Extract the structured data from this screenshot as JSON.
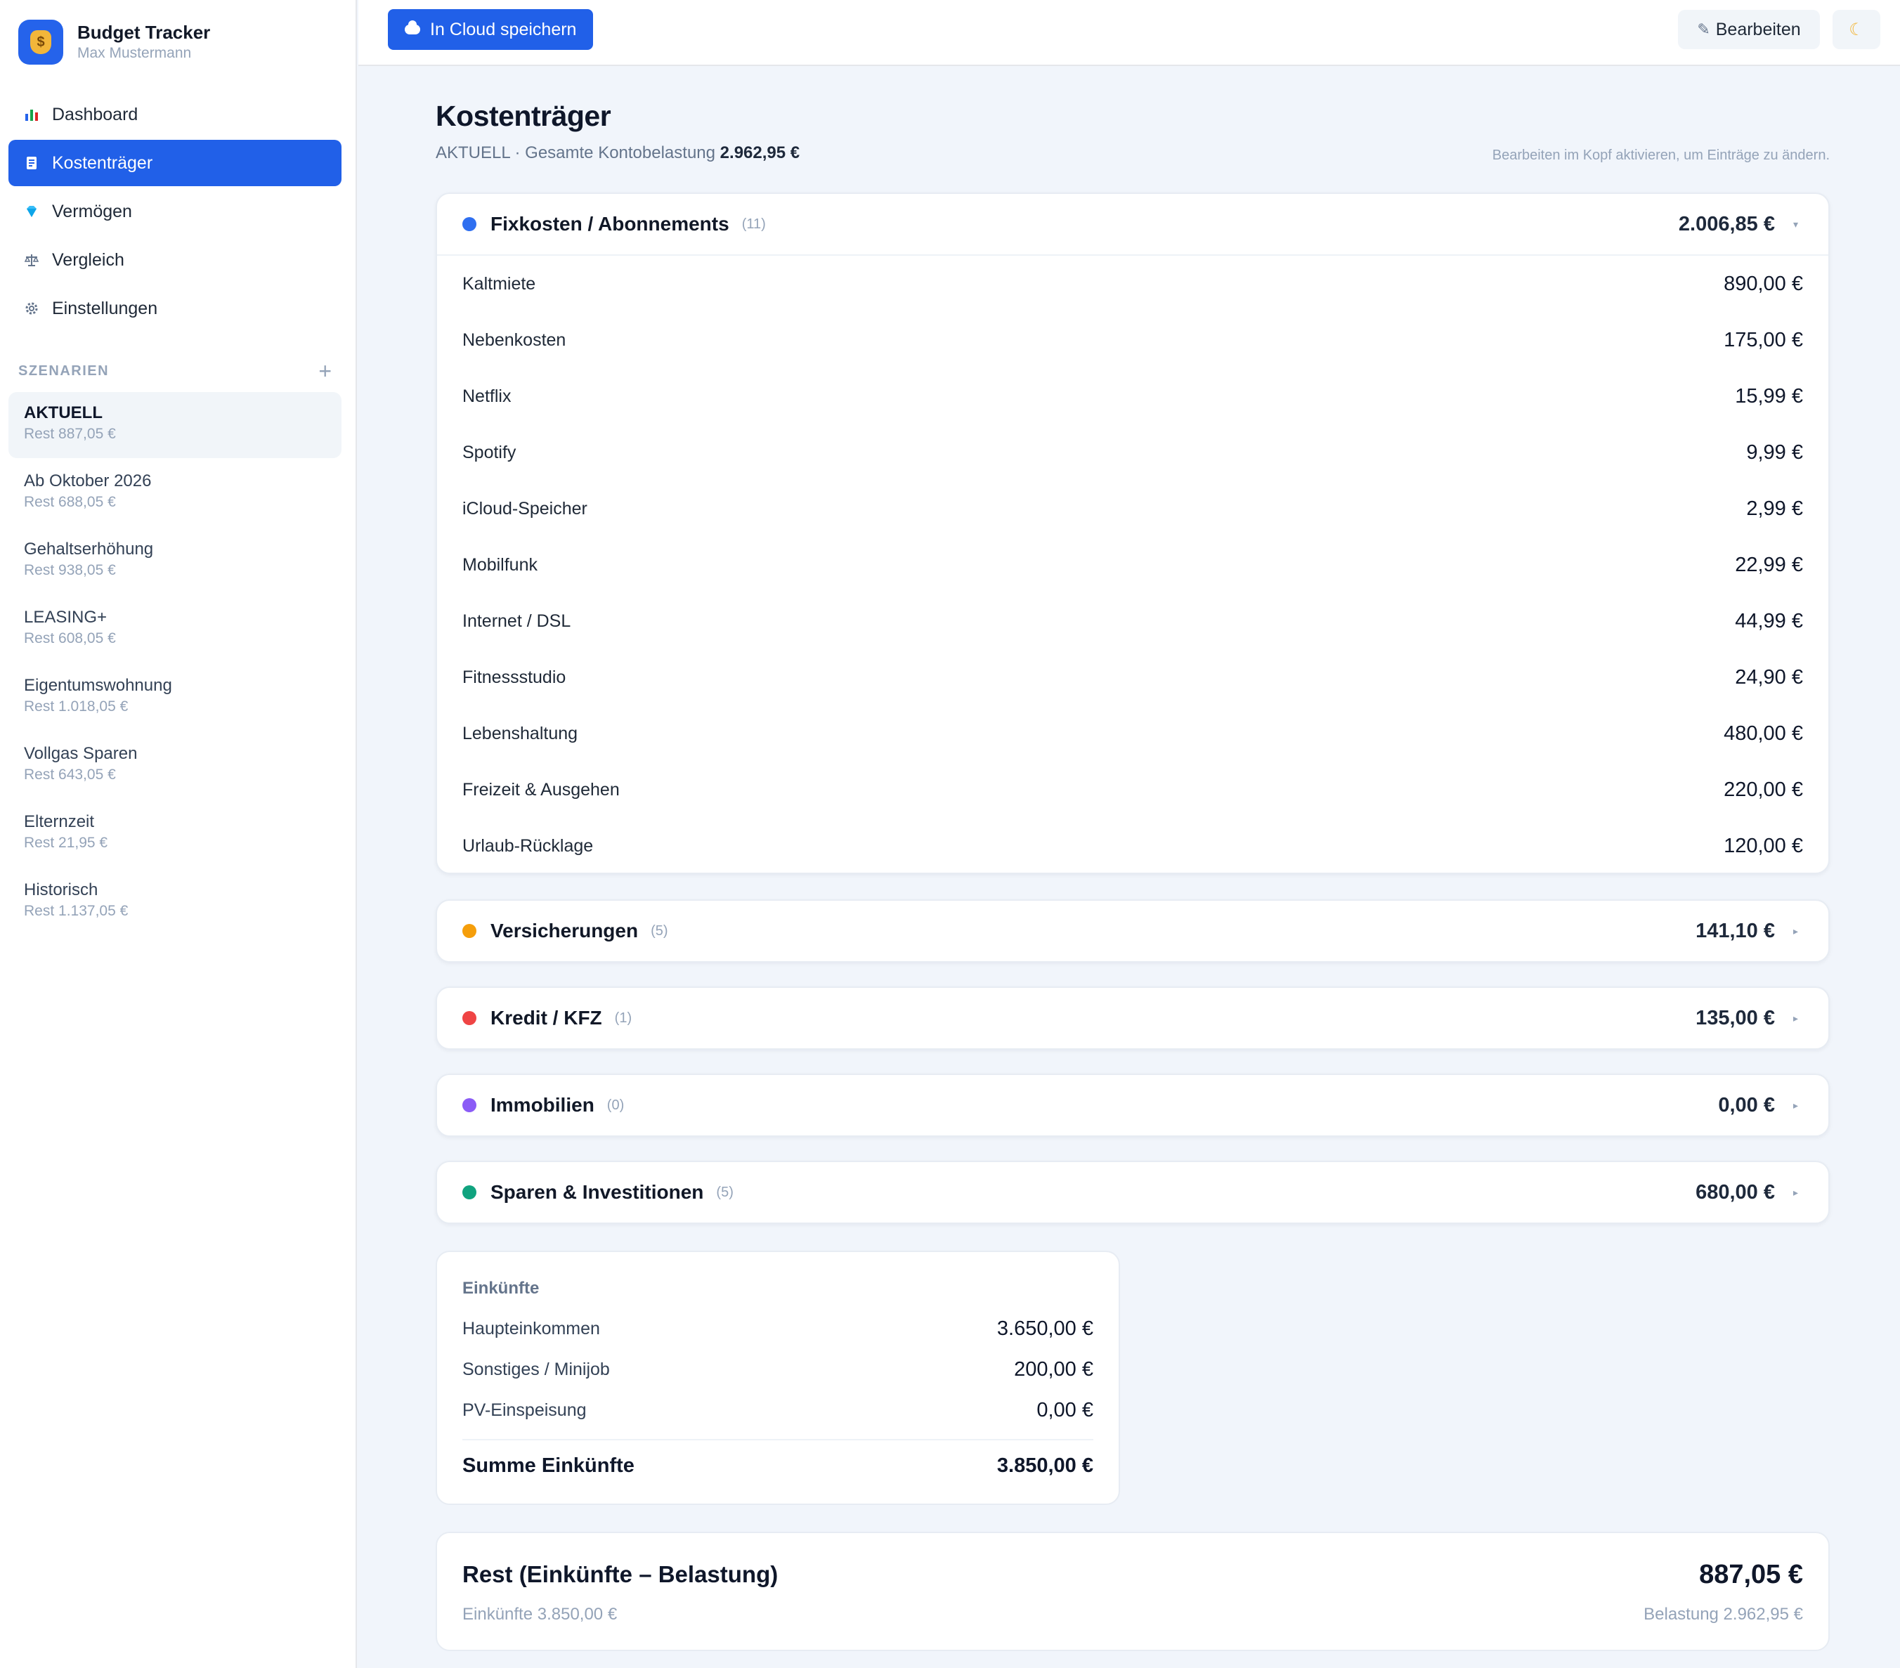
{
  "app": {
    "title": "Budget Tracker",
    "user": "Max Mustermann",
    "logo_icon": "money-bag-icon"
  },
  "nav": {
    "items": [
      {
        "label": "Dashboard",
        "icon": "bar-chart-icon",
        "active": false
      },
      {
        "label": "Kostenträger",
        "icon": "receipt-icon",
        "active": true
      },
      {
        "label": "Vermögen",
        "icon": "gem-icon",
        "active": false
      },
      {
        "label": "Vergleich",
        "icon": "scales-icon",
        "active": false
      },
      {
        "label": "Einstellungen",
        "icon": "gear-icon",
        "active": false
      }
    ]
  },
  "scenarios": {
    "title": "SZENARIEN",
    "add": "+",
    "items": [
      {
        "name": "AKTUELL",
        "rest": "Rest 887,05 €",
        "active": true
      },
      {
        "name": "Ab Oktober 2026",
        "rest": "Rest 688,05 €"
      },
      {
        "name": "Gehaltserhöhung",
        "rest": "Rest 938,05 €"
      },
      {
        "name": "LEASING+",
        "rest": "Rest 608,05 €"
      },
      {
        "name": "Eigentumswohnung",
        "rest": "Rest 1.018,05 €"
      },
      {
        "name": "Vollgas Sparen",
        "rest": "Rest 643,05 €"
      },
      {
        "name": "Elternzeit",
        "rest": "Rest 21,95 €"
      },
      {
        "name": "Historisch",
        "rest": "Rest 1.137,05 €"
      }
    ]
  },
  "topbar": {
    "cloud_label": "In Cloud speichern",
    "edit_label": "Bearbeiten",
    "theme_icon": "moon-icon"
  },
  "page": {
    "title": "Kostenträger",
    "subtitle_prefix": "AKTUELL · Gesamte Kontobelastung",
    "subtitle_value": "2.962,95 €",
    "hint": "Bearbeiten im Kopf aktivieren, um Einträge zu ändern."
  },
  "categories": [
    {
      "name": "Fixkosten / Abonnements",
      "count": "(11)",
      "sum": "2.006,85 €",
      "color": "#2f6ff0",
      "caret": "▾",
      "expanded": true,
      "items": [
        {
          "label": "Kaltmiete",
          "value": "890,00 €"
        },
        {
          "label": "Nebenkosten",
          "value": "175,00 €"
        },
        {
          "label": "Netflix",
          "value": "15,99 €"
        },
        {
          "label": "Spotify",
          "value": "9,99 €"
        },
        {
          "label": "iCloud-Speicher",
          "value": "2,99 €"
        },
        {
          "label": "Mobilfunk",
          "value": "22,99 €"
        },
        {
          "label": "Internet / DSL",
          "value": "44,99 €"
        },
        {
          "label": "Fitnessstudio",
          "value": "24,90 €"
        },
        {
          "label": "Lebenshaltung",
          "value": "480,00 €"
        },
        {
          "label": "Freizeit & Ausgehen",
          "value": "220,00 €"
        },
        {
          "label": "Urlaub-Rücklage",
          "value": "120,00 €"
        }
      ]
    },
    {
      "name": "Versicherungen",
      "count": "(5)",
      "sum": "141,10 €",
      "color": "#f59e0b",
      "caret": "▸",
      "expanded": false
    },
    {
      "name": "Kredit / KFZ",
      "count": "(1)",
      "sum": "135,00 €",
      "color": "#ef4444",
      "caret": "▸",
      "expanded": false
    },
    {
      "name": "Immobilien",
      "count": "(0)",
      "sum": "0,00 €",
      "color": "#8b5cf6",
      "caret": "▸",
      "expanded": false
    },
    {
      "name": "Sparen & Investitionen",
      "count": "(5)",
      "sum": "680,00 €",
      "color": "#10a37f",
      "caret": "▸",
      "expanded": false
    }
  ],
  "income": {
    "title": "Einkünfte",
    "items": [
      {
        "label": "Haupteinkommen",
        "value": "3.650,00 €"
      },
      {
        "label": "Sonstiges / Minijob",
        "value": "200,00 €"
      },
      {
        "label": "PV-Einspeisung",
        "value": "0,00 €"
      }
    ],
    "sum_label": "Summe Einkünfte",
    "sum_value": "3.850,00 €"
  },
  "rest": {
    "title": "Rest (Einkünfte – Belastung)",
    "value": "887,05 €",
    "income_text": "Einkünfte 3.850,00 €",
    "burden_text": "Belastung 2.962,95 €"
  }
}
